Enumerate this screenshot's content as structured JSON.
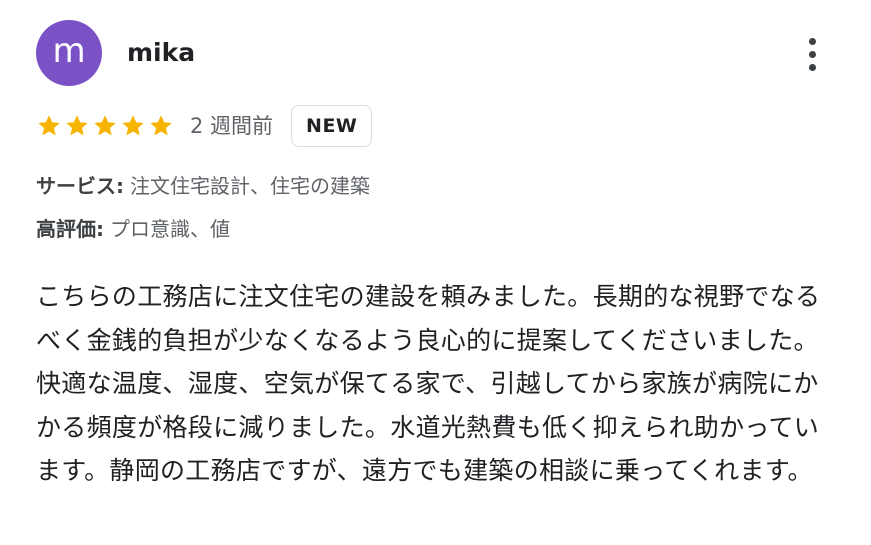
{
  "reviewer": {
    "avatar_letter": "m",
    "avatar_color": "#7b51c6",
    "name": "mika"
  },
  "menu": {
    "icon": "more-vert-icon"
  },
  "rating": {
    "stars": 5,
    "max_stars": 5,
    "star_color": "#f6b400",
    "time_ago": "2 週間前",
    "badge": "NEW"
  },
  "attributes": {
    "service_label": "サービス:",
    "service_value": "注文住宅設計、住宅の建築",
    "highlight_label": "高評価:",
    "highlight_value": "プロ意識、値"
  },
  "review": {
    "text": "こちらの工務店に注文住宅の建設を頼みました。長期的な視野でなるべく金銭的負担が少なくなるよう良心的に提案してくださいました。快適な温度、湿度、空気が保てる家で、引越してから家族が病院にかかる頻度が格段に減りました。水道光熱費も低く抑えられ助かっています。静岡の工務店ですが、遠方でも建築の相談に乗ってくれます。"
  }
}
